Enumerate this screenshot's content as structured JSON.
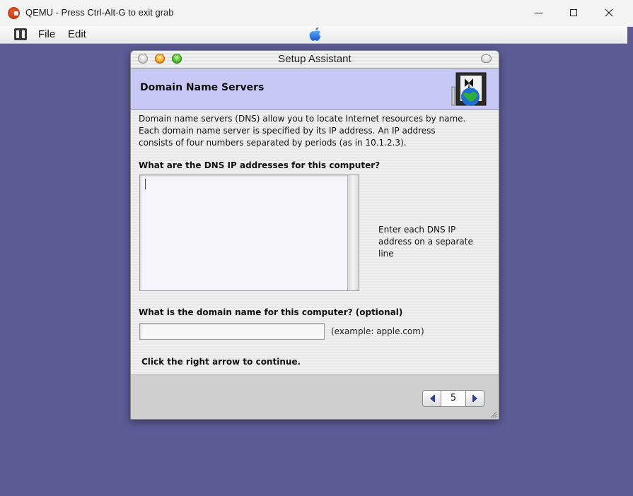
{
  "host": {
    "title": "QEMU - Press Ctrl-Alt-G to exit grab",
    "controls": [
      "minimize",
      "maximize",
      "close"
    ]
  },
  "mac_menubar": {
    "menus": [
      "File",
      "Edit"
    ],
    "icons": [
      "finder-icon",
      "apple-logo"
    ]
  },
  "window": {
    "title": "Setup Assistant",
    "section_title": "Domain Name Servers",
    "intro": "Domain name servers (DNS) allow you to locate Internet resources by name.  Each domain name server is specified by its IP address.  An IP address consists of four numbers separated by periods (as in 10.1.2.3).",
    "dns_question": "What are the DNS IP addresses for this computer?",
    "dns_value": "",
    "dns_hint": "Enter each DNS IP address on a separate line",
    "domain_question": "What is the domain name for this computer?  (optional)",
    "domain_value": "",
    "domain_example": "(example: apple.com)",
    "continue_text": "Click the right arrow to continue.",
    "page_number": "5"
  },
  "colors": {
    "desktop": "#5e5c96",
    "header_band": "#c9c8f4"
  }
}
